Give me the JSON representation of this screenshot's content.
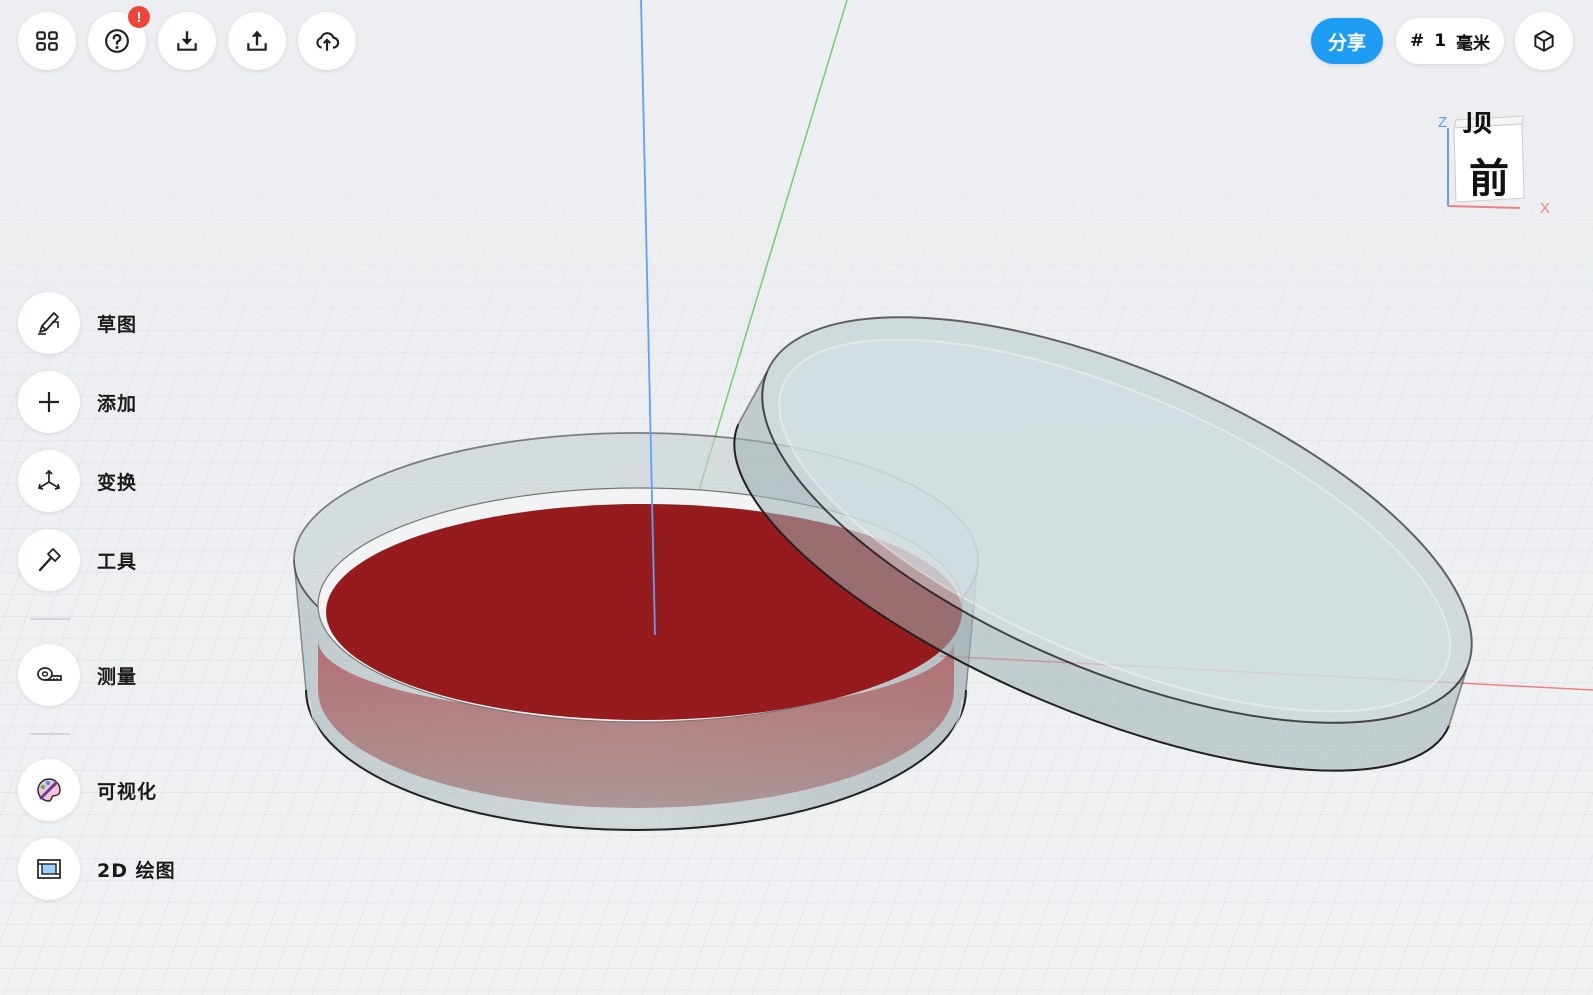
{
  "toolbar": {
    "buttons": [
      {
        "icon": "grid-icon"
      },
      {
        "icon": "help-icon",
        "badge": "!"
      },
      {
        "icon": "import-icon"
      },
      {
        "icon": "export-icon"
      },
      {
        "icon": "cloud-upload-icon"
      }
    ]
  },
  "header_right": {
    "share_label": "分享",
    "grid_symbol": "#",
    "grid_value": "1",
    "grid_unit": "毫米",
    "view_icon": "cube-view-icon"
  },
  "view_cube": {
    "top_label": "顶",
    "front_label": "前",
    "axis_z": "Z",
    "axis_x": "X"
  },
  "sidebar": {
    "items": [
      {
        "label": "草图",
        "icon": "sketch-pencil-icon"
      },
      {
        "label": "添加",
        "icon": "plus-icon"
      },
      {
        "label": "变换",
        "icon": "transform-arrows-icon"
      },
      {
        "label": "工具",
        "icon": "hammer-icon"
      },
      {
        "label": "测量",
        "icon": "tape-measure-icon"
      },
      {
        "label": "可视化",
        "icon": "palette-brush-icon"
      },
      {
        "label": "2D 绘图",
        "icon": "drawing-sheet-icon"
      }
    ]
  },
  "colors": {
    "accent": "#1c9cf2",
    "badge": "#f0443a",
    "agar": "#951b1c",
    "axis_x": "#f08080",
    "axis_y": "#6fd06f",
    "axis_z": "#5aa0ff"
  }
}
